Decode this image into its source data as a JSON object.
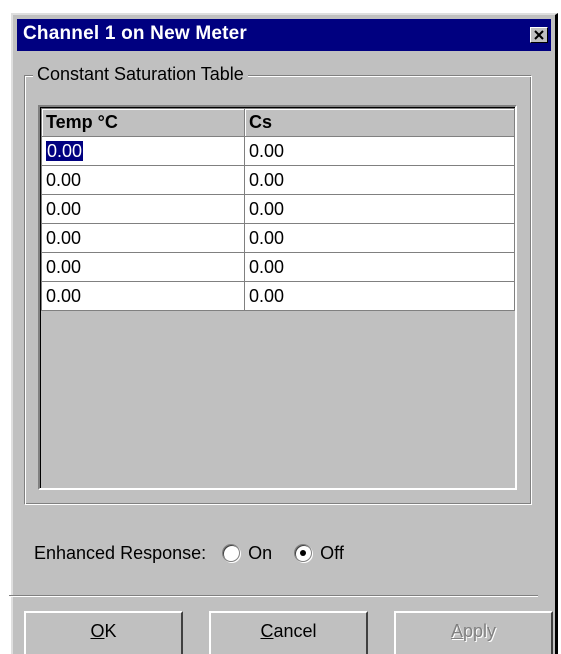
{
  "window": {
    "title": "Channel 1 on New Meter",
    "close_glyph": "✕"
  },
  "group": {
    "legend": "Constant Saturation Table"
  },
  "table": {
    "columns": [
      "Temp °C",
      "Cs"
    ],
    "rows": [
      [
        "0.00",
        "0.00"
      ],
      [
        "0.00",
        "0.00"
      ],
      [
        "0.00",
        "0.00"
      ],
      [
        "0.00",
        "0.00"
      ],
      [
        "0.00",
        "0.00"
      ],
      [
        "0.00",
        "0.00"
      ]
    ],
    "selected_cell": {
      "row": 0,
      "col": 0
    }
  },
  "enhanced_response": {
    "label": "Enhanced Response:",
    "options": [
      {
        "label": "On",
        "checked": false
      },
      {
        "label": "Off",
        "checked": true
      }
    ]
  },
  "buttons": {
    "ok": "OK",
    "cancel": "Cancel",
    "apply": "Apply"
  }
}
